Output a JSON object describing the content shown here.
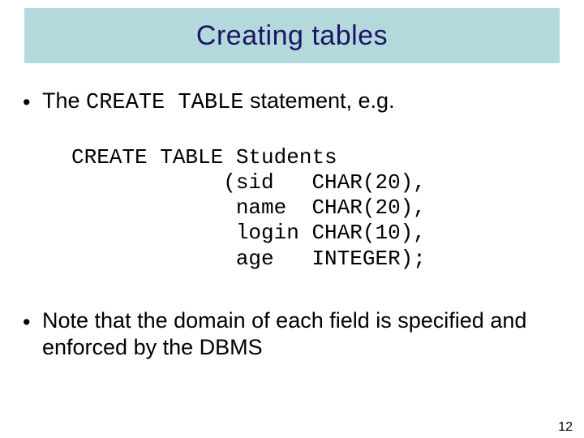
{
  "title": "Creating tables",
  "bullet1": {
    "prefix": "The ",
    "code": "CREATE TABLE",
    "suffix": " statement, e.g."
  },
  "code": {
    "l1": "CREATE TABLE Students",
    "l2": "            (sid   CHAR(20),",
    "l3": "             name  CHAR(20),",
    "l4": "             login CHAR(10),",
    "l5": "             age   INTEGER);"
  },
  "bullet2": "Note that the domain of each field is specified and enforced by the DBMS",
  "pagenum": "12",
  "dot": "•"
}
